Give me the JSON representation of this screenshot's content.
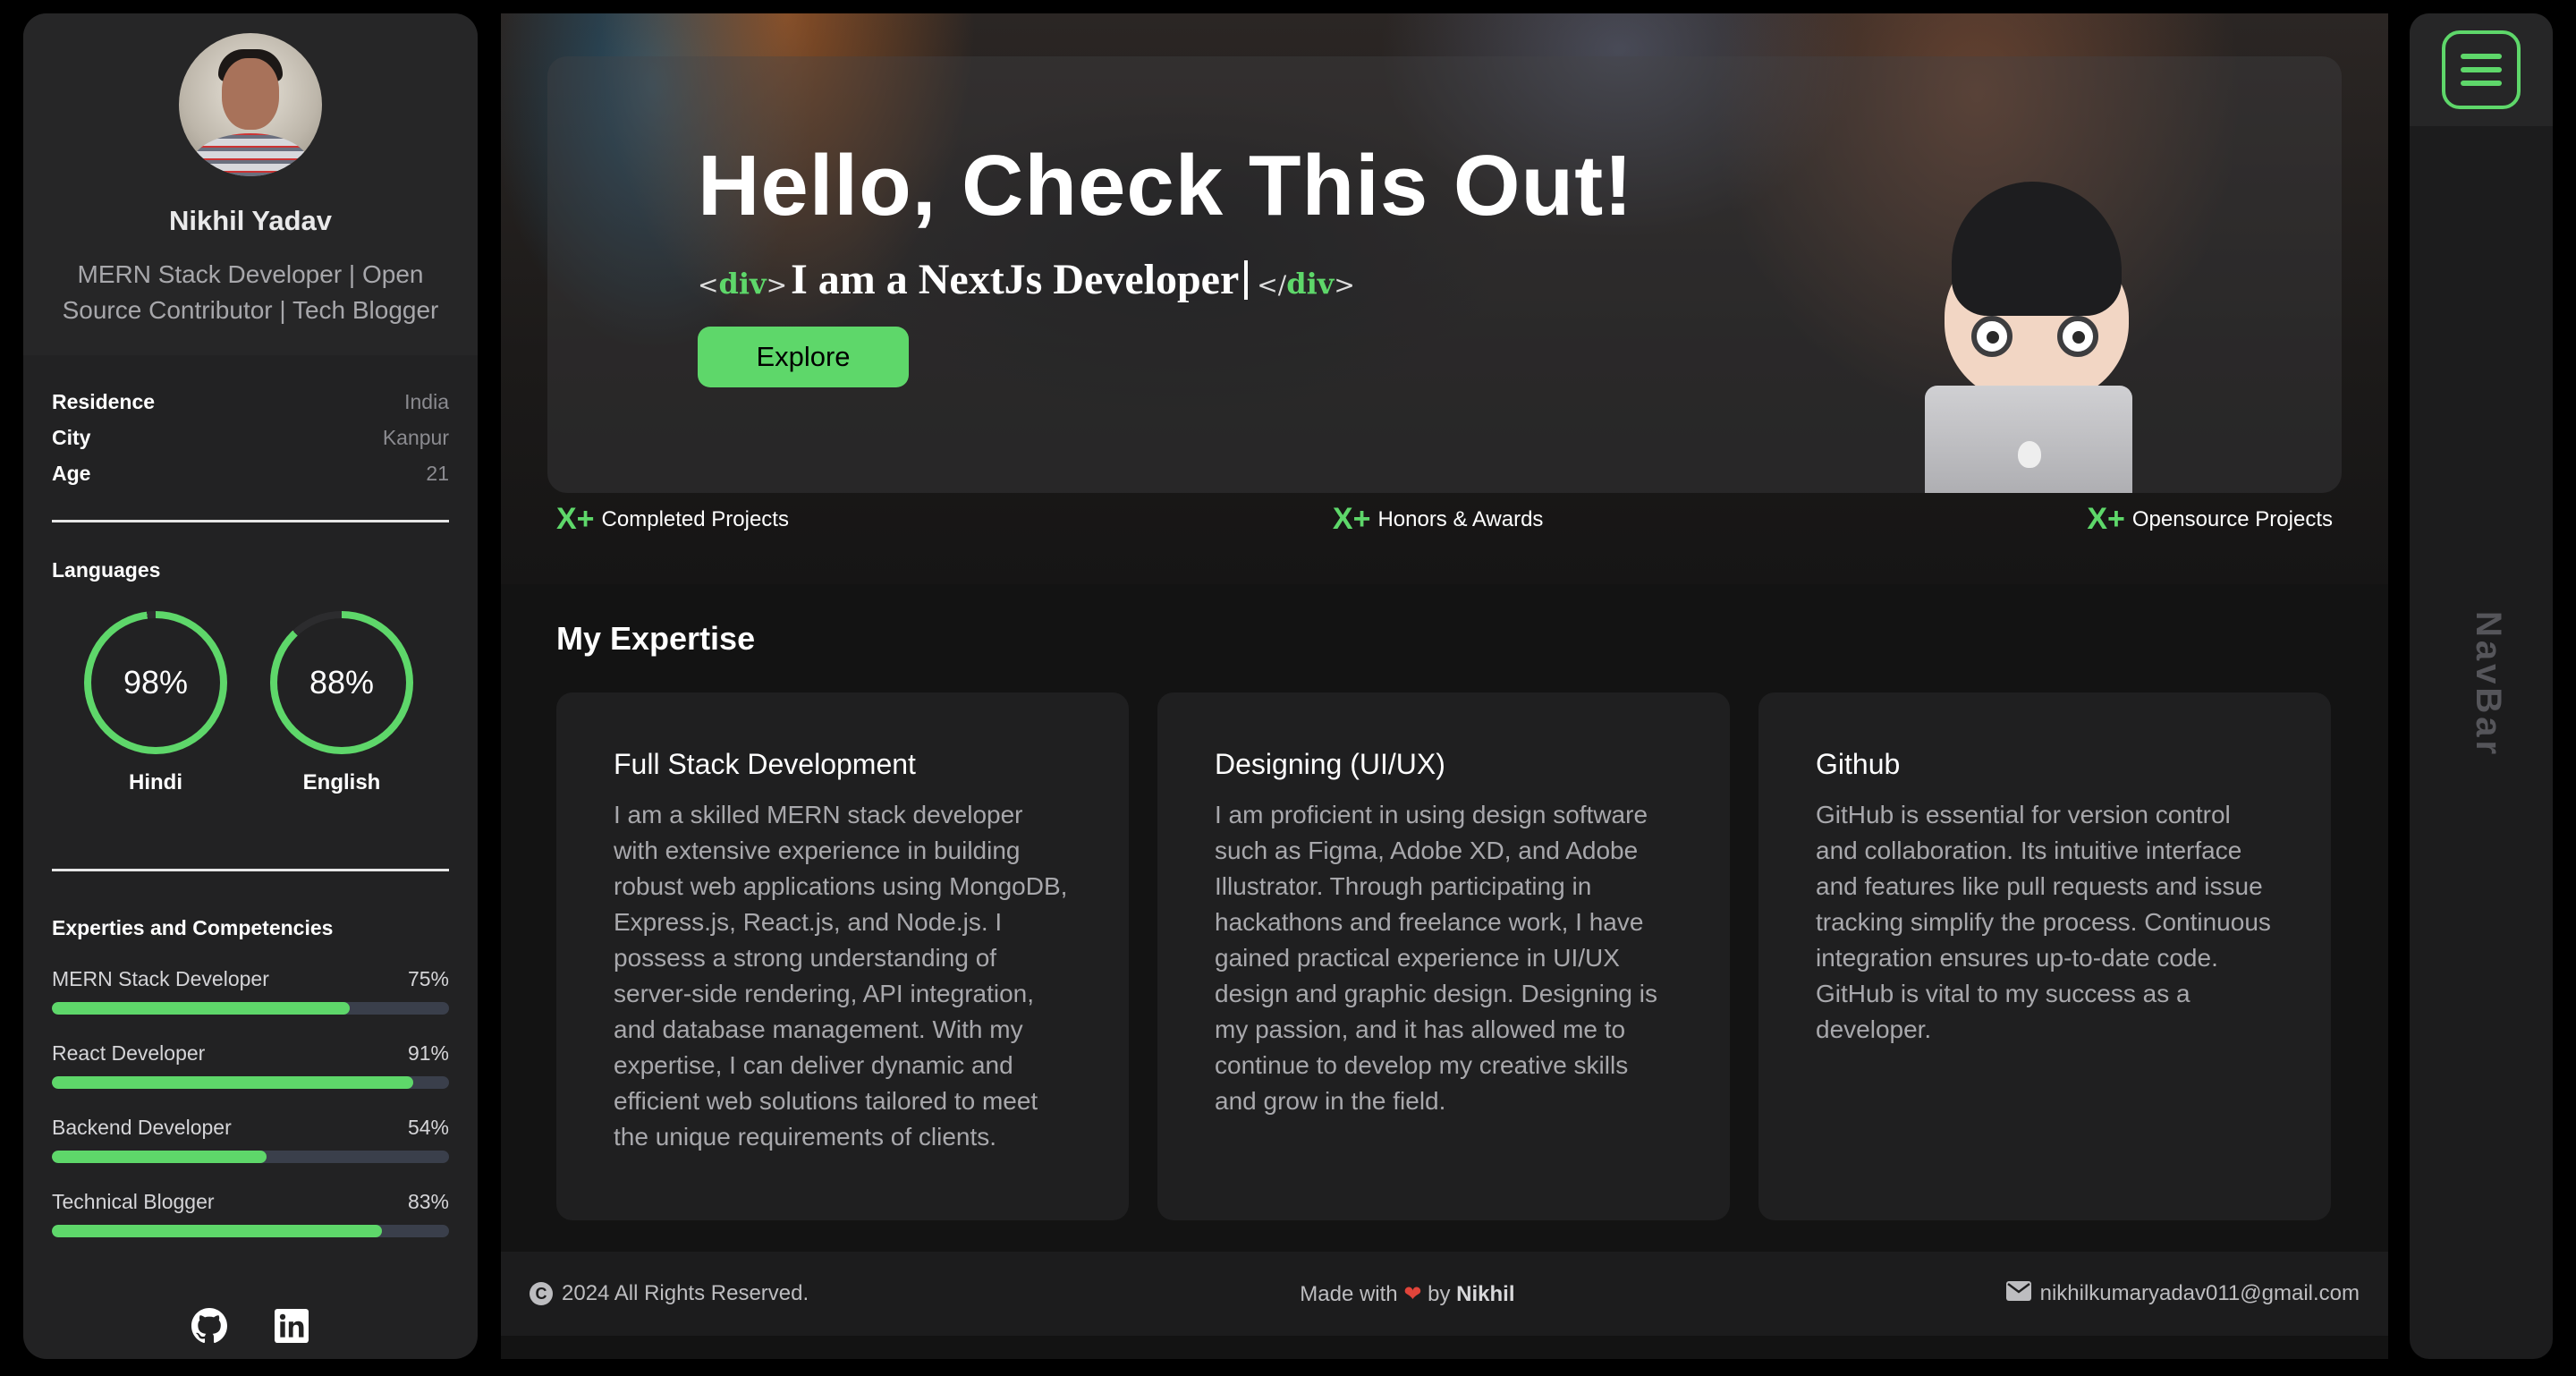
{
  "profile": {
    "name": "Nikhil Yadav",
    "role": "MERN Stack Developer | Open Source Contributor | Tech Blogger"
  },
  "info": [
    {
      "key": "Residence",
      "value": "India"
    },
    {
      "key": "City",
      "value": "Kanpur"
    },
    {
      "key": "Age",
      "value": "21"
    }
  ],
  "languages": {
    "title": "Languages",
    "items": [
      {
        "name": "Hindi",
        "percent_label": "98%",
        "percent": 98
      },
      {
        "name": "English",
        "percent_label": "88%",
        "percent": 88
      }
    ]
  },
  "skills": {
    "title": "Experties and Competencies",
    "items": [
      {
        "name": "MERN Stack Developer",
        "percent_label": "75%",
        "percent": 75
      },
      {
        "name": "React Developer",
        "percent_label": "91%",
        "percent": 91
      },
      {
        "name": "Backend Developer",
        "percent_label": "54%",
        "percent": 54
      },
      {
        "name": "Technical Blogger",
        "percent_label": "83%",
        "percent": 83
      }
    ]
  },
  "socials": [
    "github-icon",
    "linkedin-icon"
  ],
  "hero": {
    "title": "Hello, Check This Out!",
    "tag_open_left": "<",
    "tag_name": "div",
    "tag_open_right": ">",
    "typing_text": "I am a NextJs Developer",
    "tag_close_left": "</",
    "tag_close_right": ">",
    "button_label": "Explore"
  },
  "stats": [
    {
      "prefix": "X+",
      "label": "Completed Projects"
    },
    {
      "prefix": "X+",
      "label": "Honors & Awards"
    },
    {
      "prefix": "X+",
      "label": "Opensource Projects"
    }
  ],
  "expertise": {
    "title": "My Expertise",
    "cards": [
      {
        "title": "Full Stack Development",
        "text": "I am a skilled MERN stack developer with extensive experience in building robust web applications using MongoDB, Express.js, React.js, and Node.js. I possess a strong understanding of server-side rendering, API integration, and database management. With my expertise, I can deliver dynamic and efficient web solutions tailored to meet the unique requirements of clients."
      },
      {
        "title": "Designing (UI/UX)",
        "text": "I am proficient in using design software such as Figma, Adobe XD, and Adobe Illustrator. Through participating in hackathons and freelance work, I have gained practical experience in UI/UX design and graphic design. Designing is my passion, and it has allowed me to continue to develop my creative skills and grow in the field."
      },
      {
        "title": "Github",
        "text": "GitHub is essential for version control and collaboration. Its intuitive interface and features like pull requests and issue tracking simplify the process. Continuous integration ensures up-to-date code. GitHub is vital to my success as a developer."
      }
    ]
  },
  "footer": {
    "copyright_symbol": "C",
    "copyright": "2024 All Rights Reserved.",
    "made_with": "Made with",
    "heart": "❤",
    "by": "by",
    "author": "Nikhil",
    "email": "nikhilkumaryadav011@gmail.com"
  },
  "navbar": {
    "label": "NavBar"
  },
  "colors": {
    "accent": "#5ed76a",
    "background": "#131313",
    "panel": "#222223",
    "track": "#3a3f4b"
  }
}
